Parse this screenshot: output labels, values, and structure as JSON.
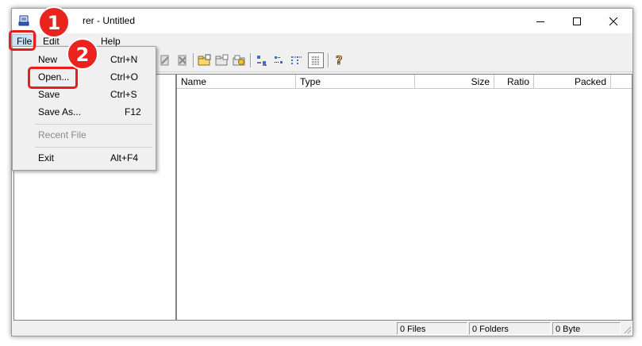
{
  "window": {
    "title": "rer - Untitled",
    "controls": {
      "minimize": "minimize",
      "maximize": "maximize",
      "close": "close"
    }
  },
  "menubar": {
    "items": [
      {
        "label": "File",
        "active": true
      },
      {
        "label": "Edit",
        "obscured": true
      },
      {
        "label": "Help"
      }
    ]
  },
  "file_menu": {
    "items": [
      {
        "label": "New",
        "shortcut": "Ctrl+N"
      },
      {
        "label": "Open...",
        "shortcut": "Ctrl+O"
      },
      {
        "label": "Save",
        "shortcut": "Ctrl+S"
      },
      {
        "label": "Save As...",
        "shortcut": "F12"
      },
      {
        "label": "Recent File",
        "disabled": true
      },
      {
        "label": "Exit",
        "shortcut": "Alt+F4"
      }
    ]
  },
  "list": {
    "columns": [
      "Name",
      "Type",
      "Size",
      "Ratio",
      "Packed"
    ],
    "rows": []
  },
  "statusbar": {
    "files": "0 Files",
    "folders": "0 Folders",
    "bytes": "0 Byte"
  },
  "annotations": {
    "step1": "1",
    "step2": "2",
    "color": "#e61e1e"
  },
  "toolbar": {
    "icons": [
      "add-file-icon",
      "extract-icon",
      "new-folder-icon",
      "folder-up-icon",
      "extract-all-icon",
      "large-icons-view-icon",
      "small-icons-view-icon",
      "list-view-icon",
      "details-view-icon",
      "help-icon"
    ]
  }
}
